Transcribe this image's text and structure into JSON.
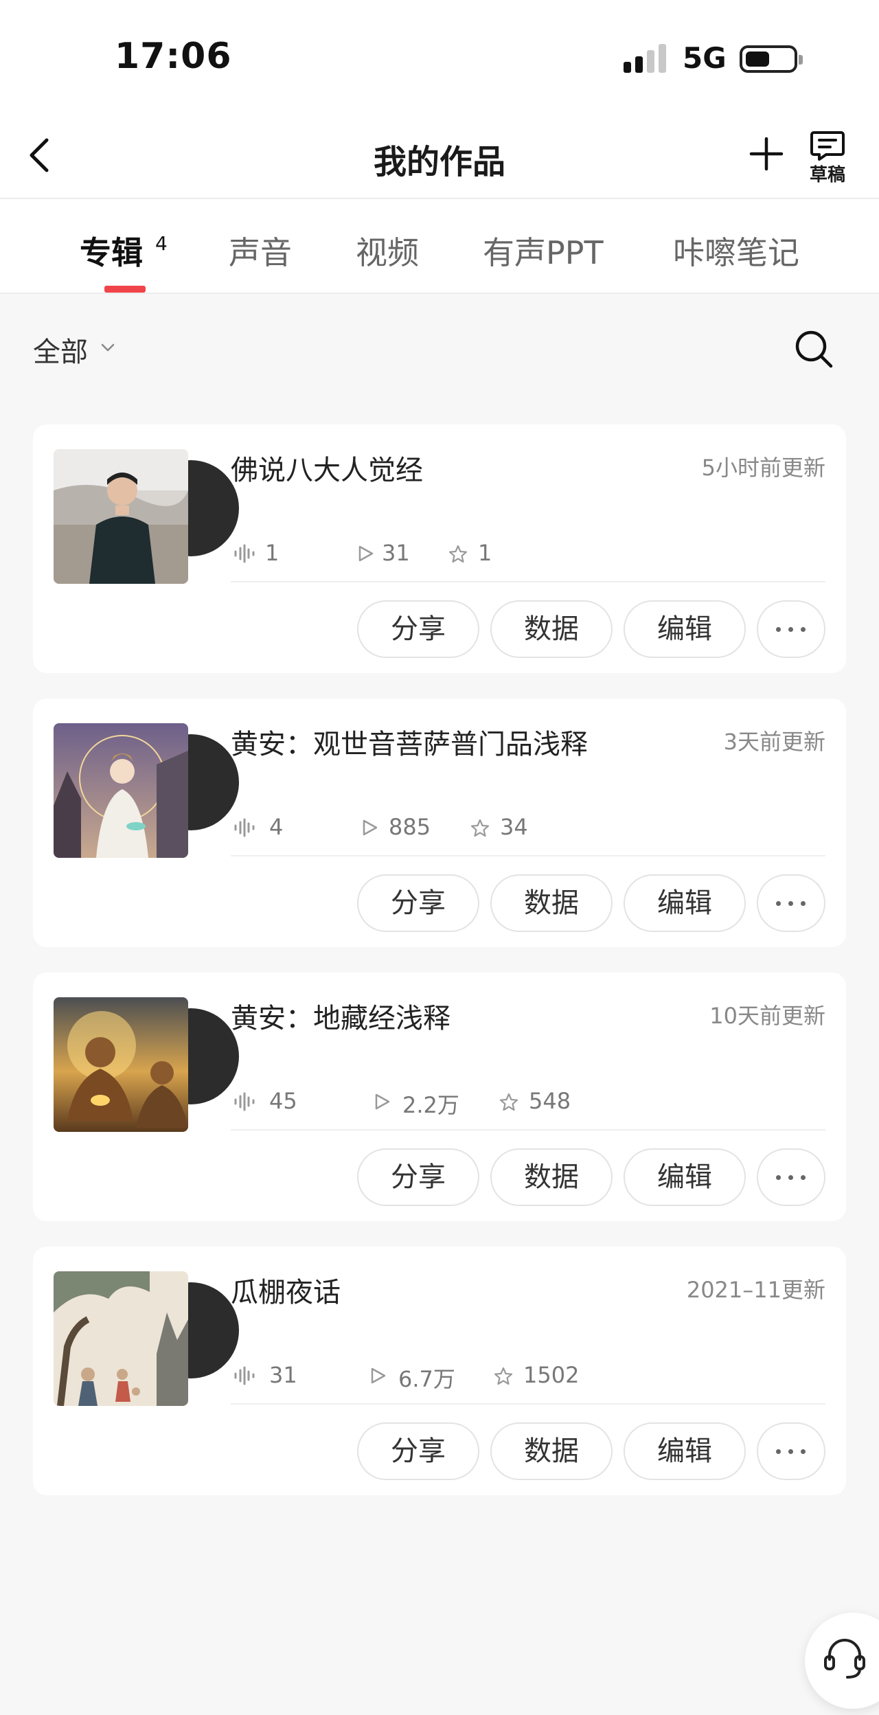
{
  "status_bar": {
    "time": "17:06",
    "network": "5G",
    "signal_icon": "cellular-signal-icon",
    "battery_icon": "battery-icon"
  },
  "nav": {
    "title": "我的作品",
    "back_icon": "chevron-left-icon",
    "add_icon": "plus-icon",
    "draft_label": "草稿",
    "draft_icon": "draft-document-icon"
  },
  "tabs": [
    {
      "label": "专辑",
      "badge": "4",
      "active": true
    },
    {
      "label": "声音"
    },
    {
      "label": "视频"
    },
    {
      "label": "有声PPT"
    },
    {
      "label": "咔嚓笔记"
    }
  ],
  "filter": {
    "label": "全部",
    "chevron_icon": "chevron-down-icon",
    "search_icon": "search-icon"
  },
  "albums": [
    {
      "title": "佛说八大人觉经",
      "updated": "5小时前更新",
      "tracks": "1",
      "plays": "31",
      "favorites": "1",
      "cover": "man-portrait"
    },
    {
      "title": "黄安：观世音菩萨普门品浅释",
      "updated": "3天前更新",
      "tracks": "4",
      "plays": "885",
      "favorites": "34",
      "cover": "guanyin"
    },
    {
      "title": "黄安：地藏经浅释",
      "updated": "10天前更新",
      "tracks": "45",
      "plays": "2.2万",
      "favorites": "548",
      "cover": "buddha-sunset"
    },
    {
      "title": "瓜棚夜话",
      "updated": "2021–11更新",
      "tracks": "31",
      "plays": "6.7万",
      "favorites": "1502",
      "cover": "ink-painting"
    }
  ],
  "actions": {
    "share": "分享",
    "data": "数据",
    "edit": "编辑",
    "more_icon": "more-dots-icon"
  },
  "stat_icons": {
    "tracks": "audio-wave-icon",
    "plays": "play-icon",
    "favorites": "star-icon"
  },
  "service_icon": "customer-service-headset-icon",
  "colors": {
    "accent": "#f0444a",
    "background": "#f7f7f7",
    "card": "#ffffff"
  }
}
